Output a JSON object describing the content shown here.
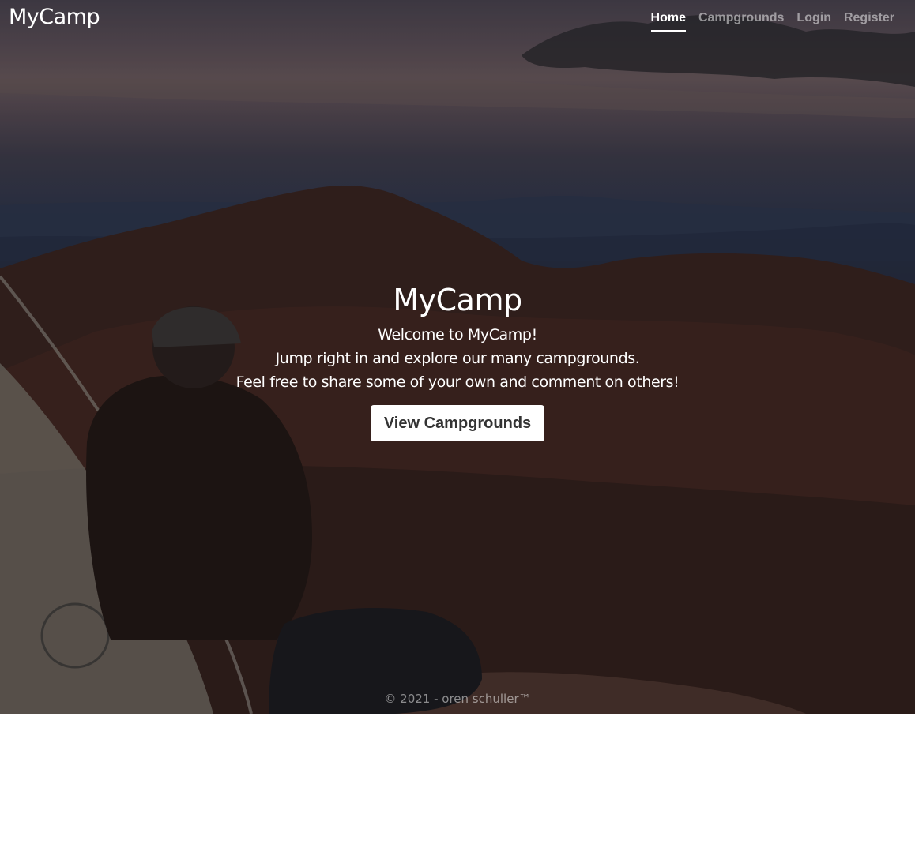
{
  "navbar": {
    "brand": "MyCamp",
    "links": [
      {
        "label": "Home",
        "active": true
      },
      {
        "label": "Campgrounds",
        "active": false
      },
      {
        "label": "Login",
        "active": false
      },
      {
        "label": "Register",
        "active": false
      }
    ]
  },
  "hero": {
    "title": "MyCamp",
    "lines": [
      "Welcome to MyCamp!",
      "Jump right in and explore our many campgrounds.",
      "Feel free to share some of your own and comment on others!"
    ],
    "cta_label": "View Campgrounds"
  },
  "footer": {
    "text": "© 2021 - oren schuller™"
  },
  "colors": {
    "text": "#ffffff",
    "muted_text": "rgba(255,255,255,0.5)",
    "button_bg": "#ffffff",
    "button_text": "#333333",
    "page_bg": "#ffffff"
  }
}
